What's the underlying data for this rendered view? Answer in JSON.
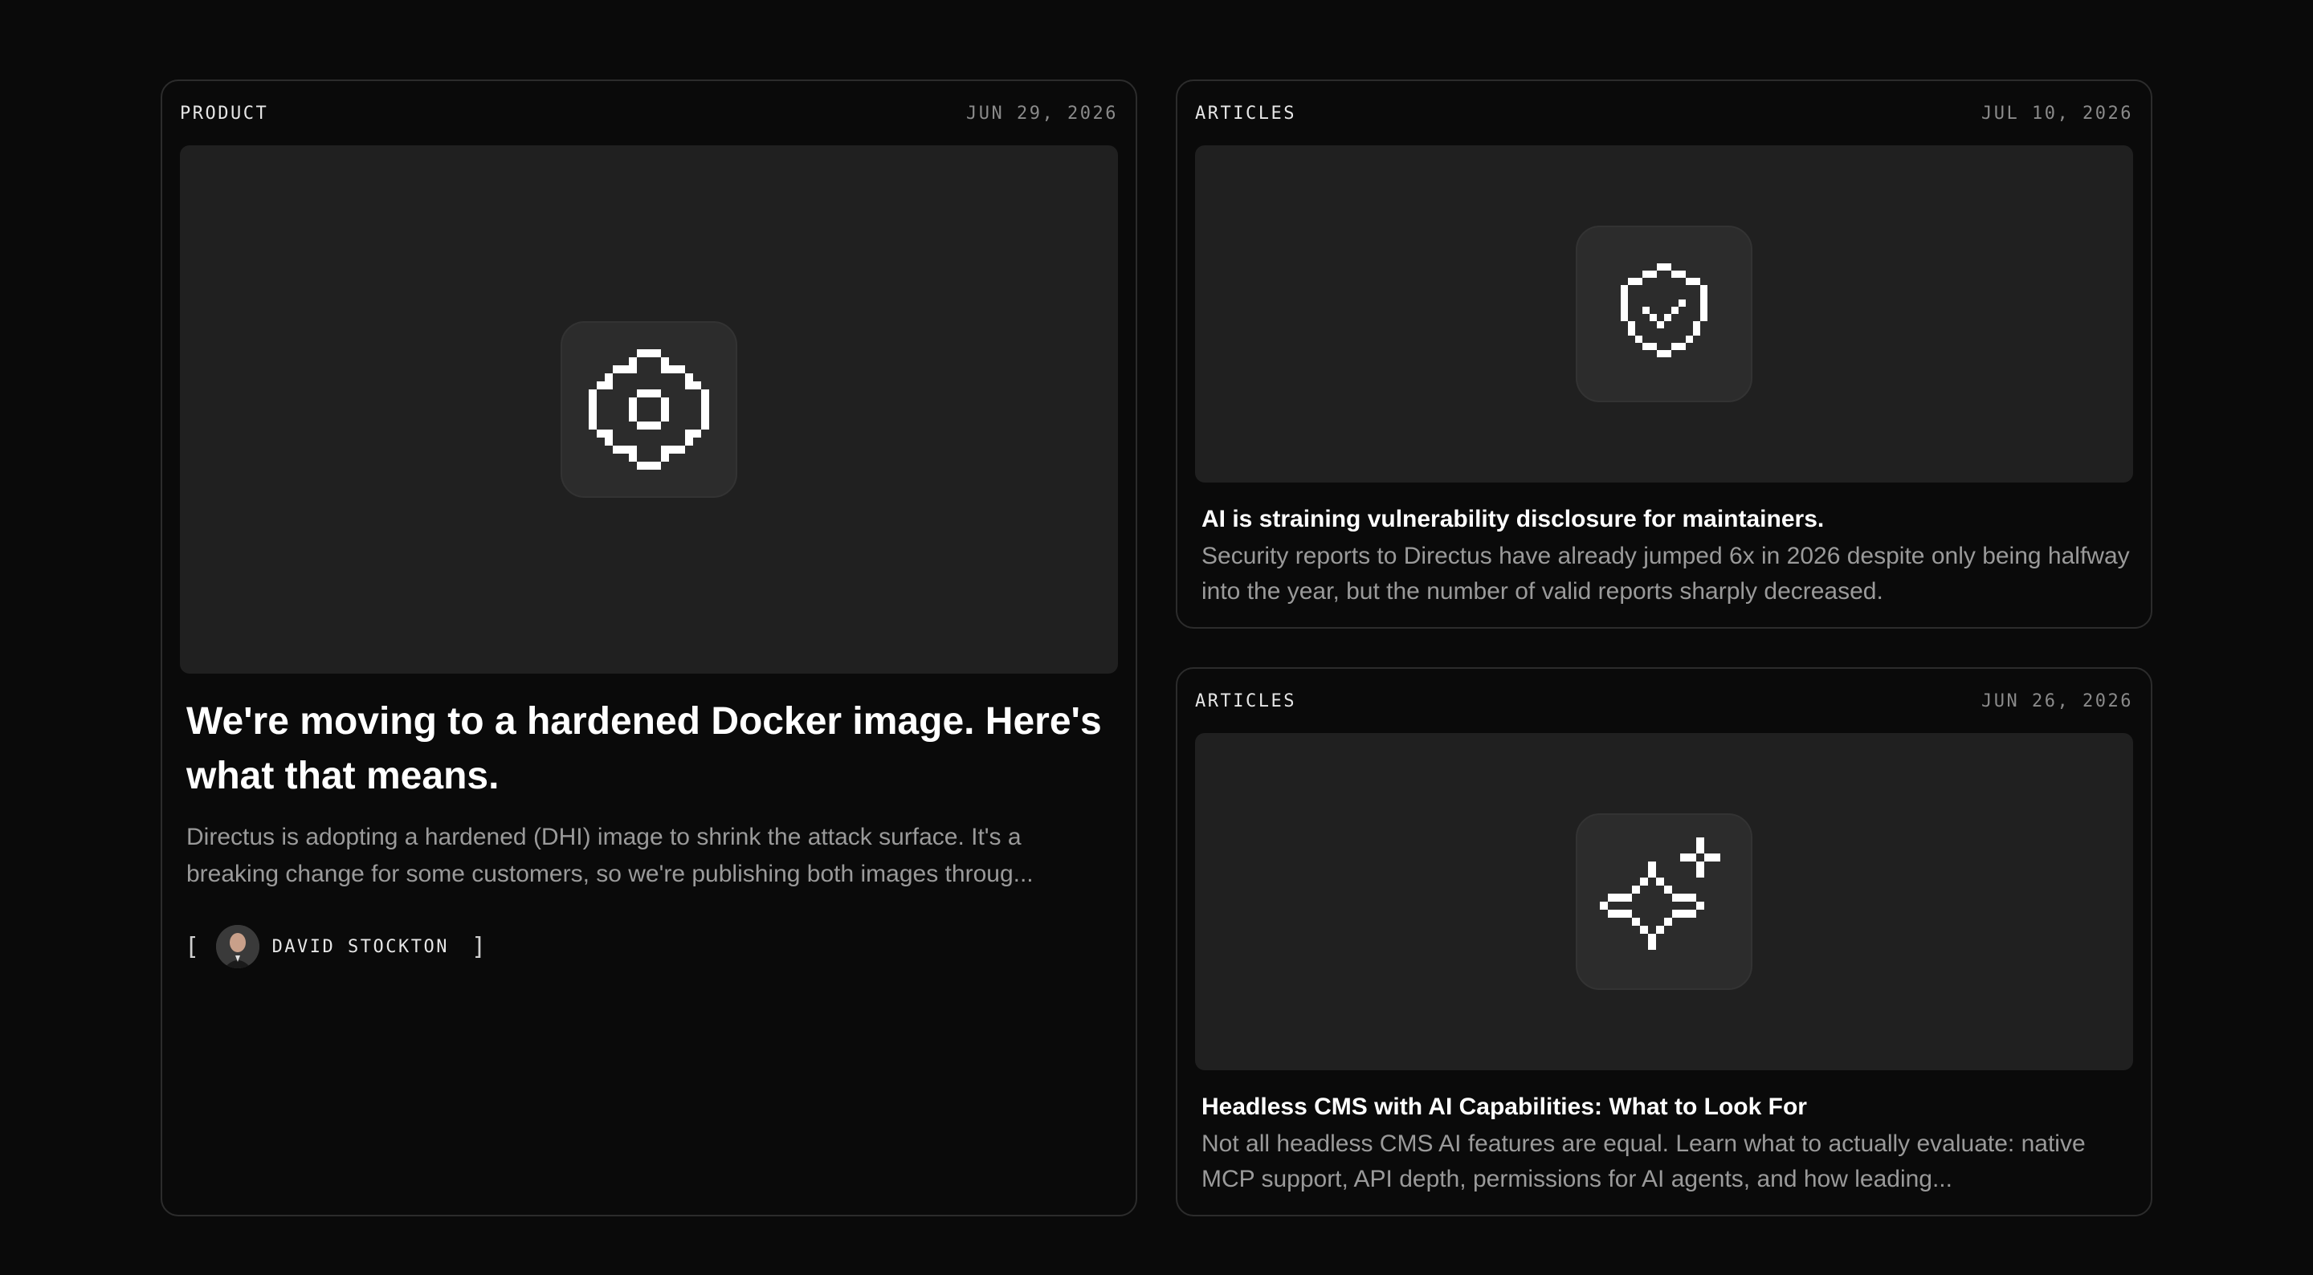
{
  "feature_post": {
    "category": "PRODUCT",
    "date": "JUN 29, 2026",
    "icon": "gear-icon",
    "title": "We're moving to a hardened Docker image. Here's what that means.",
    "excerpt": "Directus is adopting a hardened (DHI) image to shrink the attack surface. It's a breaking change for some customers, so we're publishing both images throug...",
    "author": {
      "bracket_open": "[",
      "name": "DAVID STOCKTON",
      "bracket_close": "]"
    }
  },
  "posts": [
    {
      "category": "ARTICLES",
      "date": "JUL 10, 2026",
      "icon": "shield-check-icon",
      "title": "AI is straining vulnerability disclosure for maintainers.",
      "excerpt": "Security reports to Directus have already jumped 6x in 2026 despite only being halfway into the year, but the number of valid reports sharply decreased."
    },
    {
      "category": "ARTICLES",
      "date": "JUN 26, 2026",
      "icon": "sparkle-icon",
      "title": "Headless CMS with AI Capabilities: What to Look For",
      "excerpt": "Not all headless CMS AI features are equal. Learn what to actually evaluate: native MCP support, API depth, permissions for AI agents, and how leading..."
    }
  ],
  "colors": {
    "background": "#0a0a0a",
    "card_border": "#2c2c2c",
    "thumb_background": "#202020",
    "icon_tile": "#2c2c2c",
    "muted_text": "#9a9a9a"
  }
}
